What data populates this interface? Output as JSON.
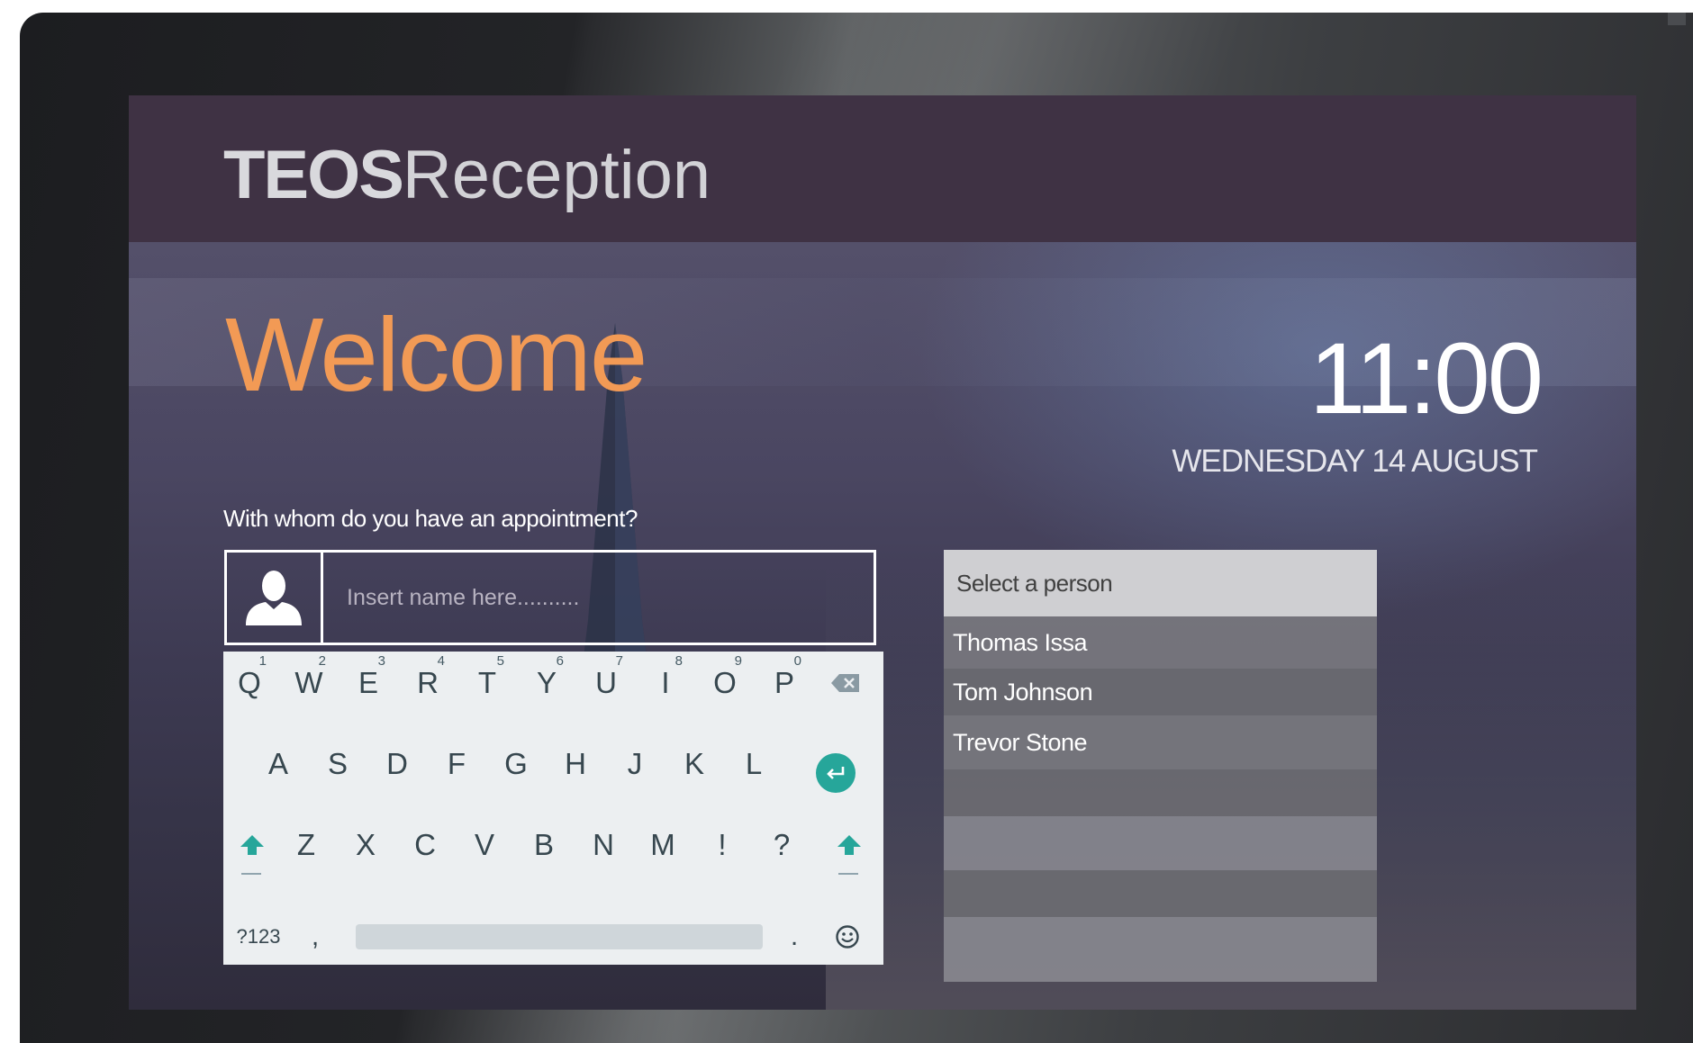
{
  "app": {
    "logo_bold": "TEOS",
    "logo_light": "Reception"
  },
  "welcome": {
    "title": "Welcome",
    "time": "11:00",
    "date": "WEDNESDAY 14 AUGUST",
    "question": "With whom do you have an appointment?"
  },
  "search": {
    "value": "",
    "placeholder": "Insert name here..........",
    "icon": "person-icon"
  },
  "keyboard": {
    "row1": [
      {
        "key": "Q",
        "hint": "1"
      },
      {
        "key": "W",
        "hint": "2"
      },
      {
        "key": "E",
        "hint": "3"
      },
      {
        "key": "R",
        "hint": "4"
      },
      {
        "key": "T",
        "hint": "5"
      },
      {
        "key": "Y",
        "hint": "6"
      },
      {
        "key": "U",
        "hint": "7"
      },
      {
        "key": "I",
        "hint": "8"
      },
      {
        "key": "O",
        "hint": "9"
      },
      {
        "key": "P",
        "hint": "0"
      }
    ],
    "row2": [
      "A",
      "S",
      "D",
      "F",
      "G",
      "H",
      "J",
      "K",
      "L"
    ],
    "row3": [
      "Z",
      "X",
      "C",
      "V",
      "B",
      "N",
      "M",
      "!",
      "?"
    ],
    "symbols_label": "?123",
    "comma": ",",
    "period": ".",
    "accent_color": "#26a69a"
  },
  "person_select": {
    "header": "Select a person",
    "options": [
      "Thomas Issa",
      "Tom  Johnson",
      "Trevor  Stone"
    ]
  },
  "colors": {
    "header_bg": "#3f3244",
    "welcome_orange": "#f29a55",
    "keyboard_bg": "#eceff1"
  }
}
